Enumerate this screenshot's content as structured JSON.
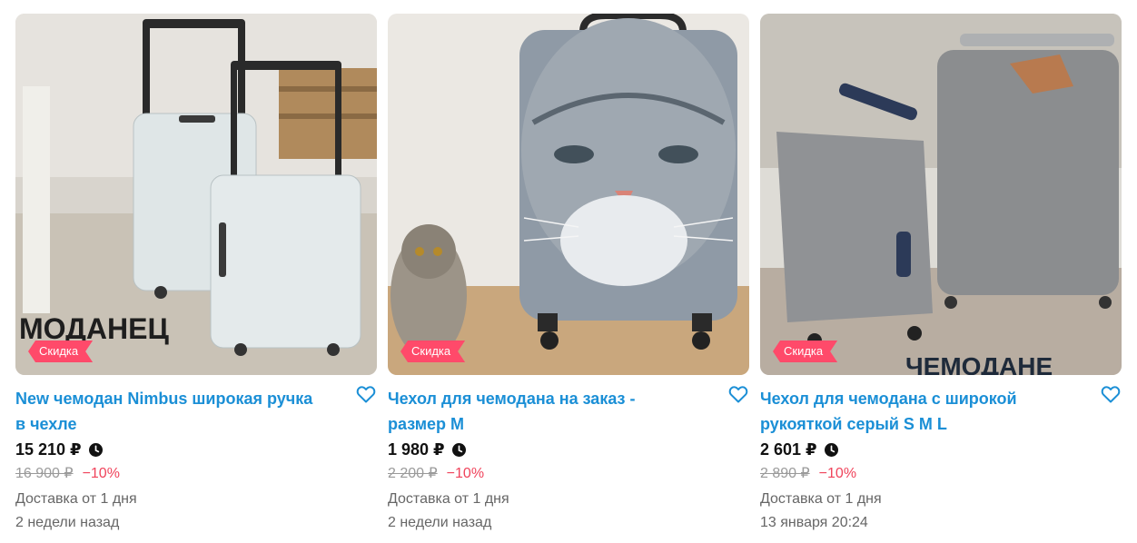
{
  "listings": [
    {
      "title": "New чемодан Nimbus широкая ручка в чехле",
      "price": "15 210 ₽",
      "old_price": "16 900 ₽",
      "discount": "−10%",
      "badge": "Скидка",
      "delivery": "Доставка от 1 дня",
      "date": "2 недели назад",
      "watermark": "МОДАНЕЦ"
    },
    {
      "title": "Чехол для чемодана на заказ - размер M",
      "price": "1 980 ₽",
      "old_price": "2 200 ₽",
      "discount": "−10%",
      "badge": "Скидка",
      "delivery": "Доставка от 1 дня",
      "date": "2 недели назад"
    },
    {
      "title": "Чехол для чемодана с широкой рукояткой серый S M L",
      "price": "2 601 ₽",
      "old_price": "2 890 ₽",
      "discount": "−10%",
      "badge": "Скидка",
      "delivery": "Доставка от 1 дня",
      "date": "13 января 20:24",
      "watermark": "ЧЕМОДАНЕ"
    }
  ],
  "icons": {
    "favorite": "heart-outline-icon",
    "timer": "clock-icon"
  },
  "colors": {
    "title": "#1b8fd6",
    "badge": "#ff4a6a",
    "discount": "#f0435b",
    "old_price": "#9a9a9a"
  }
}
